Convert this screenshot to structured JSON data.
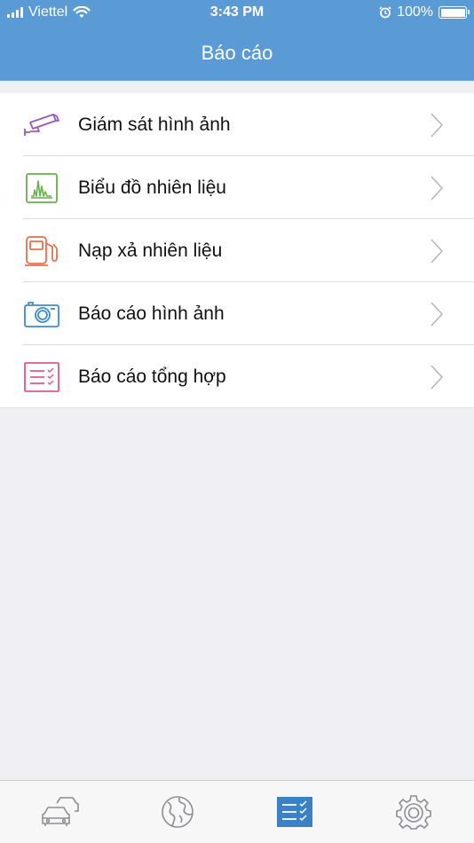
{
  "status_bar": {
    "carrier": "Viettel",
    "time": "3:43 PM",
    "battery": "100%"
  },
  "header": {
    "title": "Báo cáo"
  },
  "menu": {
    "items": [
      {
        "label": "Giám sát hình ảnh",
        "icon": "cctv-camera-icon",
        "color": "#9b59b6"
      },
      {
        "label": "Biểu đồ nhiên liệu",
        "icon": "fuel-chart-icon",
        "color": "#6ab04c"
      },
      {
        "label": "Nạp xả nhiên liệu",
        "icon": "fuel-pump-icon",
        "color": "#e8704a"
      },
      {
        "label": "Báo cáo hình ảnh",
        "icon": "camera-icon",
        "color": "#3c8dcd"
      },
      {
        "label": "Báo cáo tổng hợp",
        "icon": "checklist-icon",
        "color": "#e05a8c"
      }
    ]
  },
  "tabbar": {
    "tabs": [
      {
        "icon": "vehicles-icon",
        "active": false
      },
      {
        "icon": "globe-icon",
        "active": false
      },
      {
        "icon": "report-list-icon",
        "active": true
      },
      {
        "icon": "settings-icon",
        "active": false
      }
    ],
    "active_color": "#3b82c4",
    "inactive_color": "#8e8e93"
  }
}
